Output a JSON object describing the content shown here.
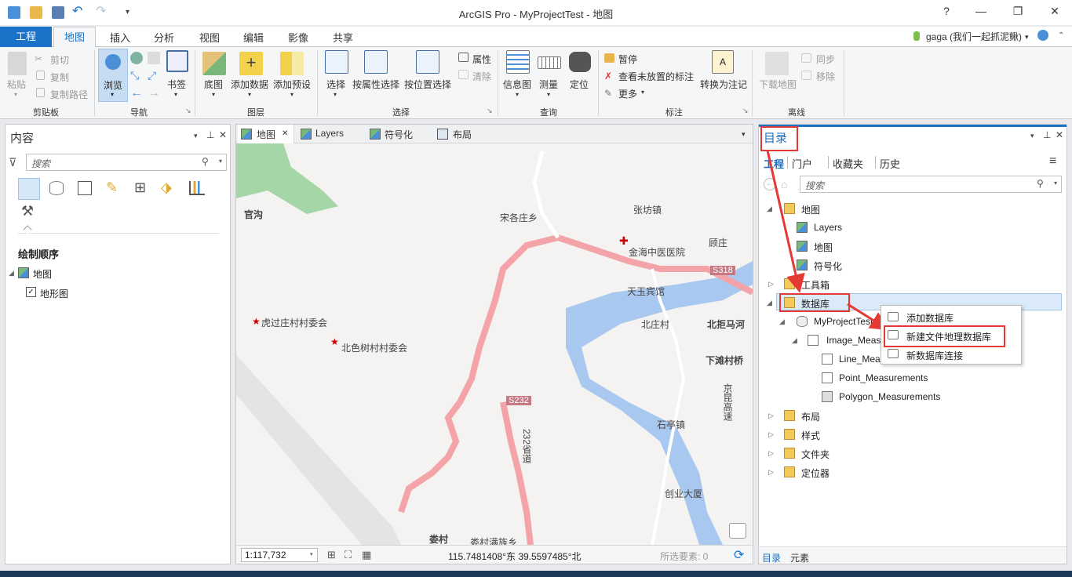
{
  "app": {
    "title": "ArcGIS Pro - MyProjectTest - 地图"
  },
  "window_controls": {
    "help": "?",
    "minimize": "—",
    "maximize": "❐",
    "close": "✕"
  },
  "tabs": {
    "project": "工程",
    "map": "地图",
    "insert": "插入",
    "analysis": "分析",
    "view": "视图",
    "edit": "编辑",
    "imagery": "影像",
    "share": "共享"
  },
  "user": {
    "name": "gaga (我们一起抓泥鳅)",
    "dropdown": "▾"
  },
  "ribbon": {
    "clipboard": {
      "paste": "粘贴",
      "cut": "剪切",
      "copy": "复制",
      "copy_path": "复制路径",
      "group": "剪贴板"
    },
    "navigate": {
      "explore": "浏览",
      "bookmarks": "书签",
      "group": "导航"
    },
    "layer": {
      "basemap": "底图",
      "add_data": "添加数据",
      "add_preset": "添加预设",
      "group": "图层"
    },
    "selection": {
      "select": "选择",
      "by_attr": "按属性选择",
      "by_loc": "按位置选择",
      "attributes": "属性",
      "clear": "清除",
      "group": "选择"
    },
    "inquiry": {
      "infographics": "信息图",
      "measure": "测量",
      "locate": "定位",
      "group": "查询"
    },
    "labeling": {
      "pause": "暂停",
      "view_unplaced": "查看未放置的标注",
      "more": "更多",
      "convert": "转换为注记",
      "group": "标注"
    },
    "offline": {
      "download": "下载地图",
      "sync": "同步",
      "remove": "移除",
      "group": "离线"
    }
  },
  "contents": {
    "title": "内容",
    "search_placeholder": "搜索",
    "drawing_order": "绘制顺序",
    "map_label": "地图",
    "layer_label": "地形图"
  },
  "map_view": {
    "tabs": [
      "地图",
      "Layers",
      "符号化",
      "布局"
    ],
    "scale": "1:117,732",
    "coords": "115.7481408°东 39.5597485°北",
    "selected_features": "所选要素: 0"
  },
  "map_labels": {
    "guangou": "官沟",
    "songge": "宋各庄乡",
    "zhangfang": "张坊镇",
    "hospital": "金海中医医院",
    "guzhuang": "顾庄",
    "s318": "S318",
    "tianyu": "天玉宾馆",
    "beizhuang": "北庄村",
    "beijuma": "北拒马河",
    "huguo": "虎过庄村村委会",
    "beise": "北色树村村委会",
    "xiatan": "下滩村桥",
    "s232": "S232",
    "road232": "232省道",
    "jingkun": "京昆高速",
    "shiting": "石亭镇",
    "chuangye": "创业大厦",
    "loucun": "娄村",
    "loucun_town": "娄村满族乡"
  },
  "catalog": {
    "title": "目录",
    "tabs": [
      "工程",
      "门户",
      "收藏夹",
      "历史"
    ],
    "search_placeholder": "搜索",
    "tree": {
      "maps": "地图",
      "layers": "Layers",
      "map": "地图",
      "symbology": "符号化",
      "toolboxes": "工具箱",
      "databases": "数据库",
      "gdb": "MyProjectTest",
      "image_meas": "Image_Measurements",
      "line_meas": "Line_Measurements",
      "point_meas": "Point_Measurements",
      "poly_meas": "Polygon_Measurements",
      "layouts": "布局",
      "styles": "样式",
      "folders": "文件夹",
      "locators": "定位器"
    },
    "bottom_tabs": [
      "目录",
      "元素"
    ]
  },
  "context_menu": {
    "add_db": "添加数据库",
    "new_fgdb": "新建文件地理数据库",
    "new_db_conn": "新数据库连接"
  },
  "colors": {
    "accent": "#1a73c9",
    "highlight": "#e53935",
    "road": "#f4a3a8",
    "water": "#a9c8f0",
    "forest": "#a5d6a7"
  }
}
